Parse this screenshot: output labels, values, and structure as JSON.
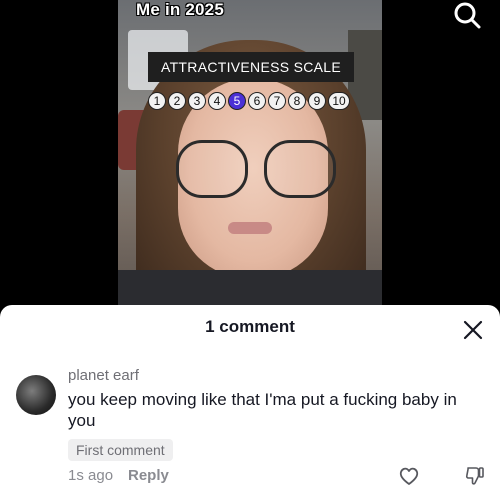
{
  "video": {
    "overlay_title": "Me in 2025",
    "scale_label": "ATTRACTIVENESS SCALE",
    "scale_values": [
      "1",
      "2",
      "3",
      "4",
      "5",
      "6",
      "7",
      "8",
      "9",
      "10"
    ],
    "selected_value": "5",
    "selected_color": "#4b30d6"
  },
  "header": {
    "search_icon": "search-icon"
  },
  "sheet": {
    "title": "1 comment",
    "close_icon": "close-icon",
    "comments": [
      {
        "username": "planet earf",
        "text": "you keep moving like that I'ma put a fucking baby in you",
        "badge": "First comment",
        "time": "1s ago",
        "reply_label": "Reply"
      }
    ]
  }
}
